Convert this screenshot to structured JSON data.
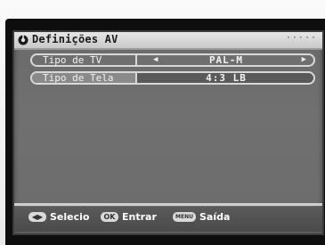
{
  "window": {
    "title": "Definições AV",
    "title_icon": "setup-disc-icon",
    "title_decoration": "·····"
  },
  "settings": [
    {
      "label": "Tipo de TV",
      "value": "PAL-M",
      "has_arrows": true,
      "state": "selected"
    },
    {
      "label": "Tipo de Tela",
      "value": "4:3 LB",
      "has_arrows": false,
      "state": "active"
    }
  ],
  "footer": {
    "nav_key_icon": "left-right-arrows-icon",
    "select_label": "Selecio",
    "ok_key": "OK",
    "enter_label": "Entrar",
    "menu_key": "MENU",
    "exit_label": "Saída"
  },
  "colors": {
    "osd_background": "#6c6c6c",
    "title_bar": "#d6d6d6",
    "footer_background": "#505050",
    "row_border": "#d8d8d8",
    "text": "#f2f2f2"
  }
}
